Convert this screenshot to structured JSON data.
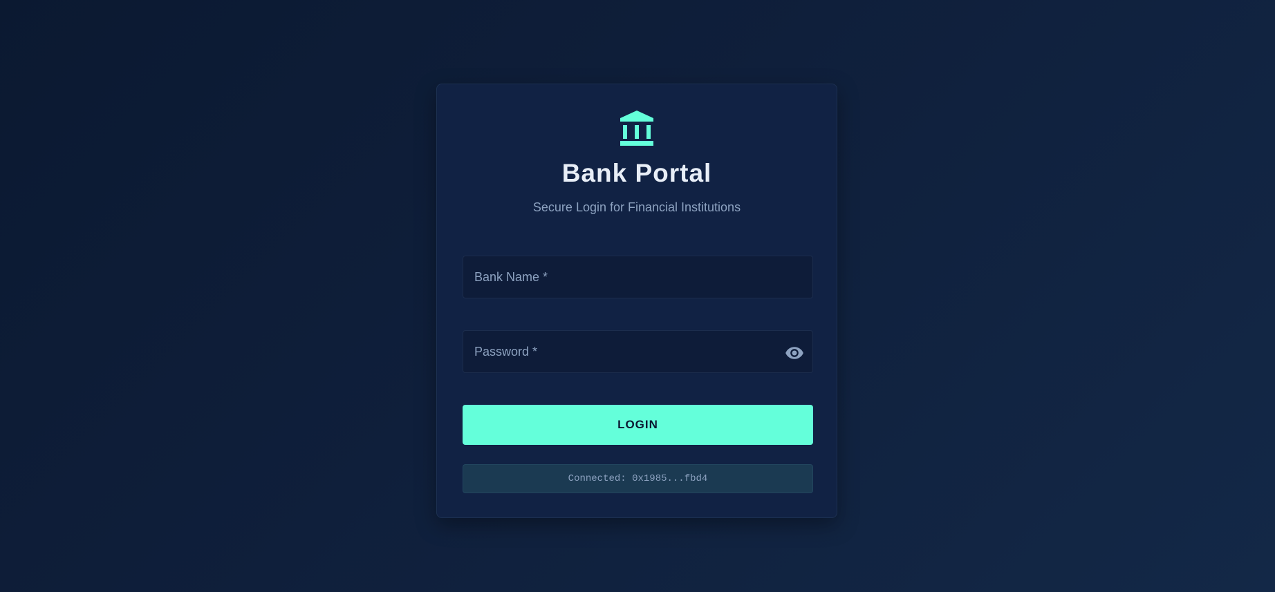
{
  "header": {
    "logo_icon": "bank-icon",
    "title": "Bank Portal",
    "subtitle": "Secure Login for Financial Institutions"
  },
  "form": {
    "bank_name": {
      "value": "",
      "placeholder": "Bank Name *"
    },
    "password": {
      "value": "",
      "placeholder": "Password *",
      "toggle_icon": "eye-icon"
    },
    "login_label": "LOGIN"
  },
  "status": {
    "text": "Connected: 0x1985...fbd4"
  },
  "colors": {
    "background": "#0f1f3b",
    "card": "#112244",
    "accent": "#64ffda",
    "title": "#e8eef7",
    "muted_text": "#8da2c0",
    "status_bg": "#1b3a52"
  }
}
